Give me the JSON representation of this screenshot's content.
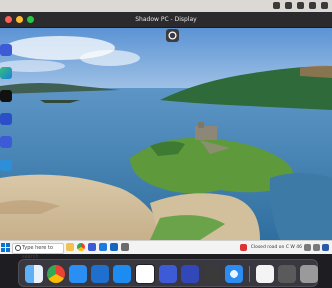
{
  "window": {
    "title": "Shadow PC - Display"
  },
  "taskbar": {
    "search_placeholder": "Type here to search",
    "tray_note": "Closed road on C W 46"
  },
  "colors": {
    "sky": "#5b93d4",
    "water": "#4a86b8",
    "shadow_accent": "#3d5bd6",
    "taskbar_bg": "#f3f3f3",
    "dock_bg": "#3c3a42"
  },
  "icons": {
    "menubar": [
      "control-center-icon",
      "battery-icon",
      "wifi-icon",
      "search-icon",
      "user-icon"
    ],
    "desktop": [
      "shadow-app-icon",
      "edge-icon",
      "shadow-app-icon",
      "settings-icon",
      "shadow-app-icon",
      "shortcut-icon"
    ],
    "taskbar": [
      "windows-start-icon",
      "explorer-icon",
      "chrome-icon",
      "shadow-icon",
      "store-icon",
      "mail-icon",
      "settings-icon"
    ],
    "dock": [
      "finder-icon",
      "chrome-icon",
      "mail-icon",
      "vscode-icon",
      "app-store-icon",
      "notion-icon",
      "shadow-icon",
      "shadow-beta-icon",
      "apple-tv-icon",
      "safari-icon",
      "document-icon",
      "preview-icon",
      "trash-icon"
    ]
  }
}
